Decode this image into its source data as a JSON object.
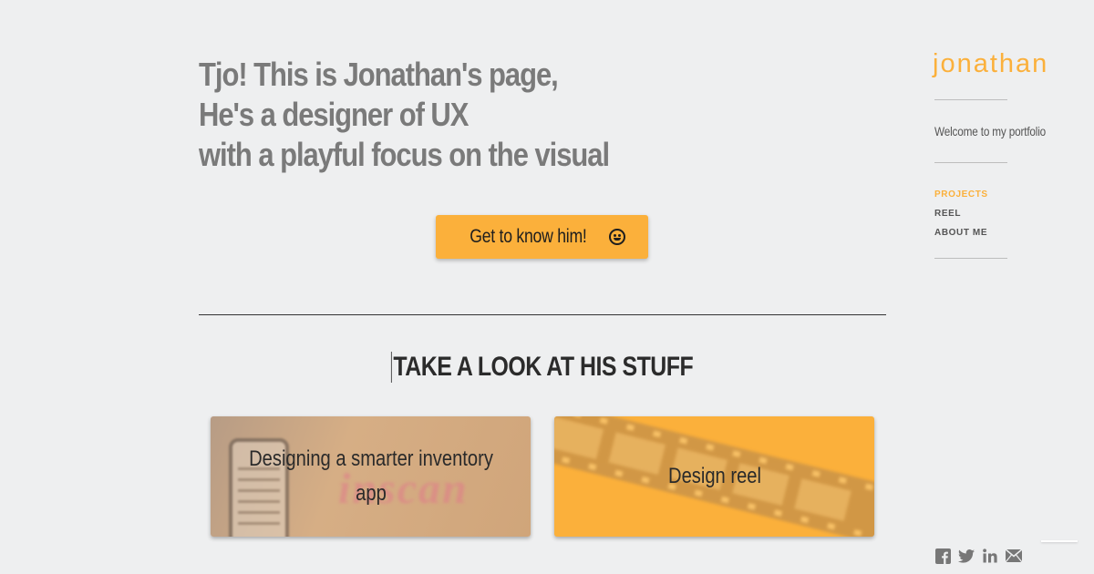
{
  "hero": {
    "line1": "Tjo! This is Jonathan's page,",
    "line2": "He's a designer of UX",
    "line3": "with a playful focus on the visual",
    "cta_label": "Get to know him!"
  },
  "section": {
    "title": "TAKE A LOOK AT HIS STUFF"
  },
  "cards": [
    {
      "label": "Designing a smarter inventory app",
      "decor_word": "inscan"
    },
    {
      "label": "Design reel"
    }
  ],
  "sidebar": {
    "brand": "jonathan",
    "welcome": "Welcome to my portfolio",
    "nav": [
      {
        "label": "PROJECTS",
        "active": true
      },
      {
        "label": "REEL",
        "active": false
      },
      {
        "label": "ABOUT ME",
        "active": false
      }
    ],
    "social": [
      "facebook-icon",
      "twitter-icon",
      "linkedin-icon",
      "mail-icon"
    ]
  },
  "colors": {
    "accent": "#fbb03b",
    "background": "#eeeff0",
    "hero_text": "#7a7a7a"
  }
}
